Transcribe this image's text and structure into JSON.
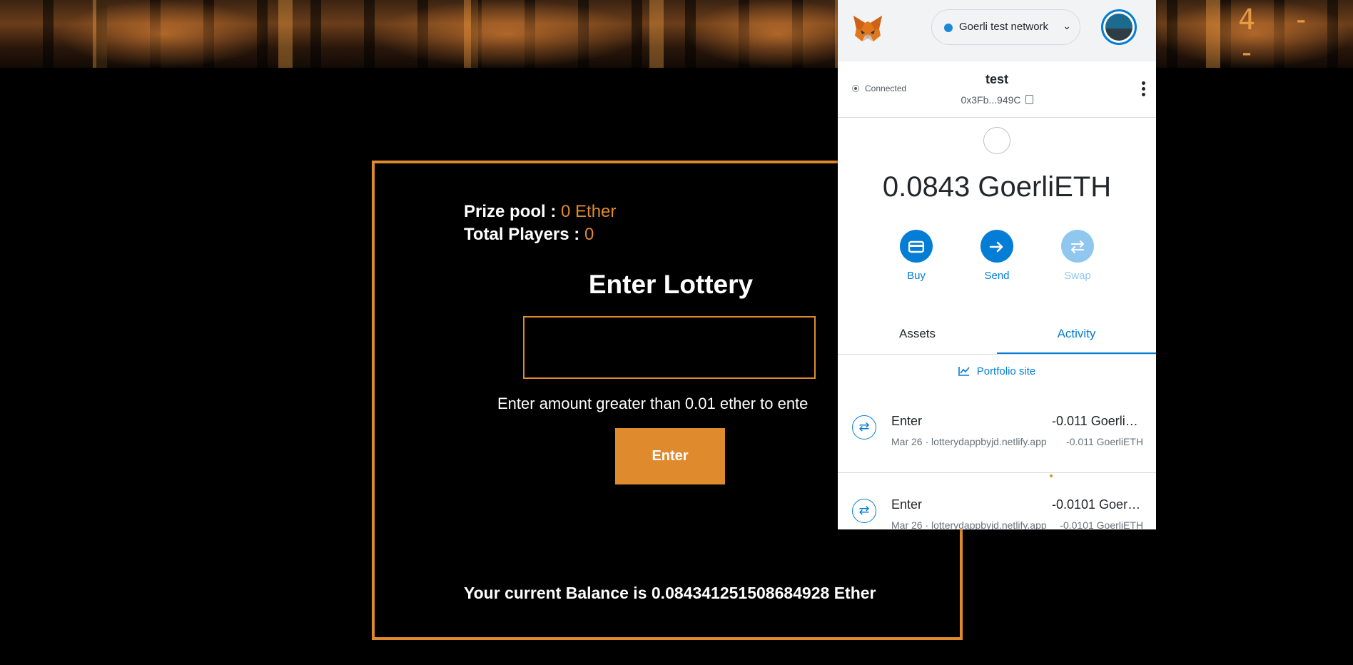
{
  "dapp": {
    "prize_label": "Prize pool :",
    "prize_value": "0 Ether",
    "players_label": "Total Players :",
    "players_value": "0",
    "title": "Enter Lottery",
    "amount_value": "",
    "hint": "Enter amount greater than 0.01 ether to ente",
    "enter_button": "Enter",
    "balance": "Your current Balance is 0.084341251508684928 Ether",
    "hero_digits": "4 - -"
  },
  "metamask": {
    "network": "Goerli test network",
    "status": "Connected",
    "account_name": "test",
    "account_address": "0x3Fb...949C",
    "balance": "0.0843 GoerliETH",
    "actions": [
      {
        "label": "Buy",
        "icon": "card-icon"
      },
      {
        "label": "Send",
        "icon": "arrow-right-icon"
      },
      {
        "label": "Swap",
        "icon": "swap-icon"
      }
    ],
    "tabs": [
      "Assets",
      "Activity"
    ],
    "active_tab": "Activity",
    "portfolio_link": "Portfolio site",
    "transactions": [
      {
        "title": "Enter",
        "subtitle": "Mar 26 · lotterydappbyjd.netlify.app",
        "amount": "-0.011 GoerliETH",
        "amount_secondary": "-0.011 GoerliETH"
      },
      {
        "title": "Enter",
        "subtitle": "Mar 26 · lotterydappbyjd.netlify.app",
        "amount": "-0.0101 GoerliETH",
        "amount_secondary": "-0.0101 GoerliETH"
      }
    ]
  },
  "colors": {
    "accent_orange": "#e08a2e",
    "metamask_blue": "#037dd6",
    "background": "#000000"
  }
}
